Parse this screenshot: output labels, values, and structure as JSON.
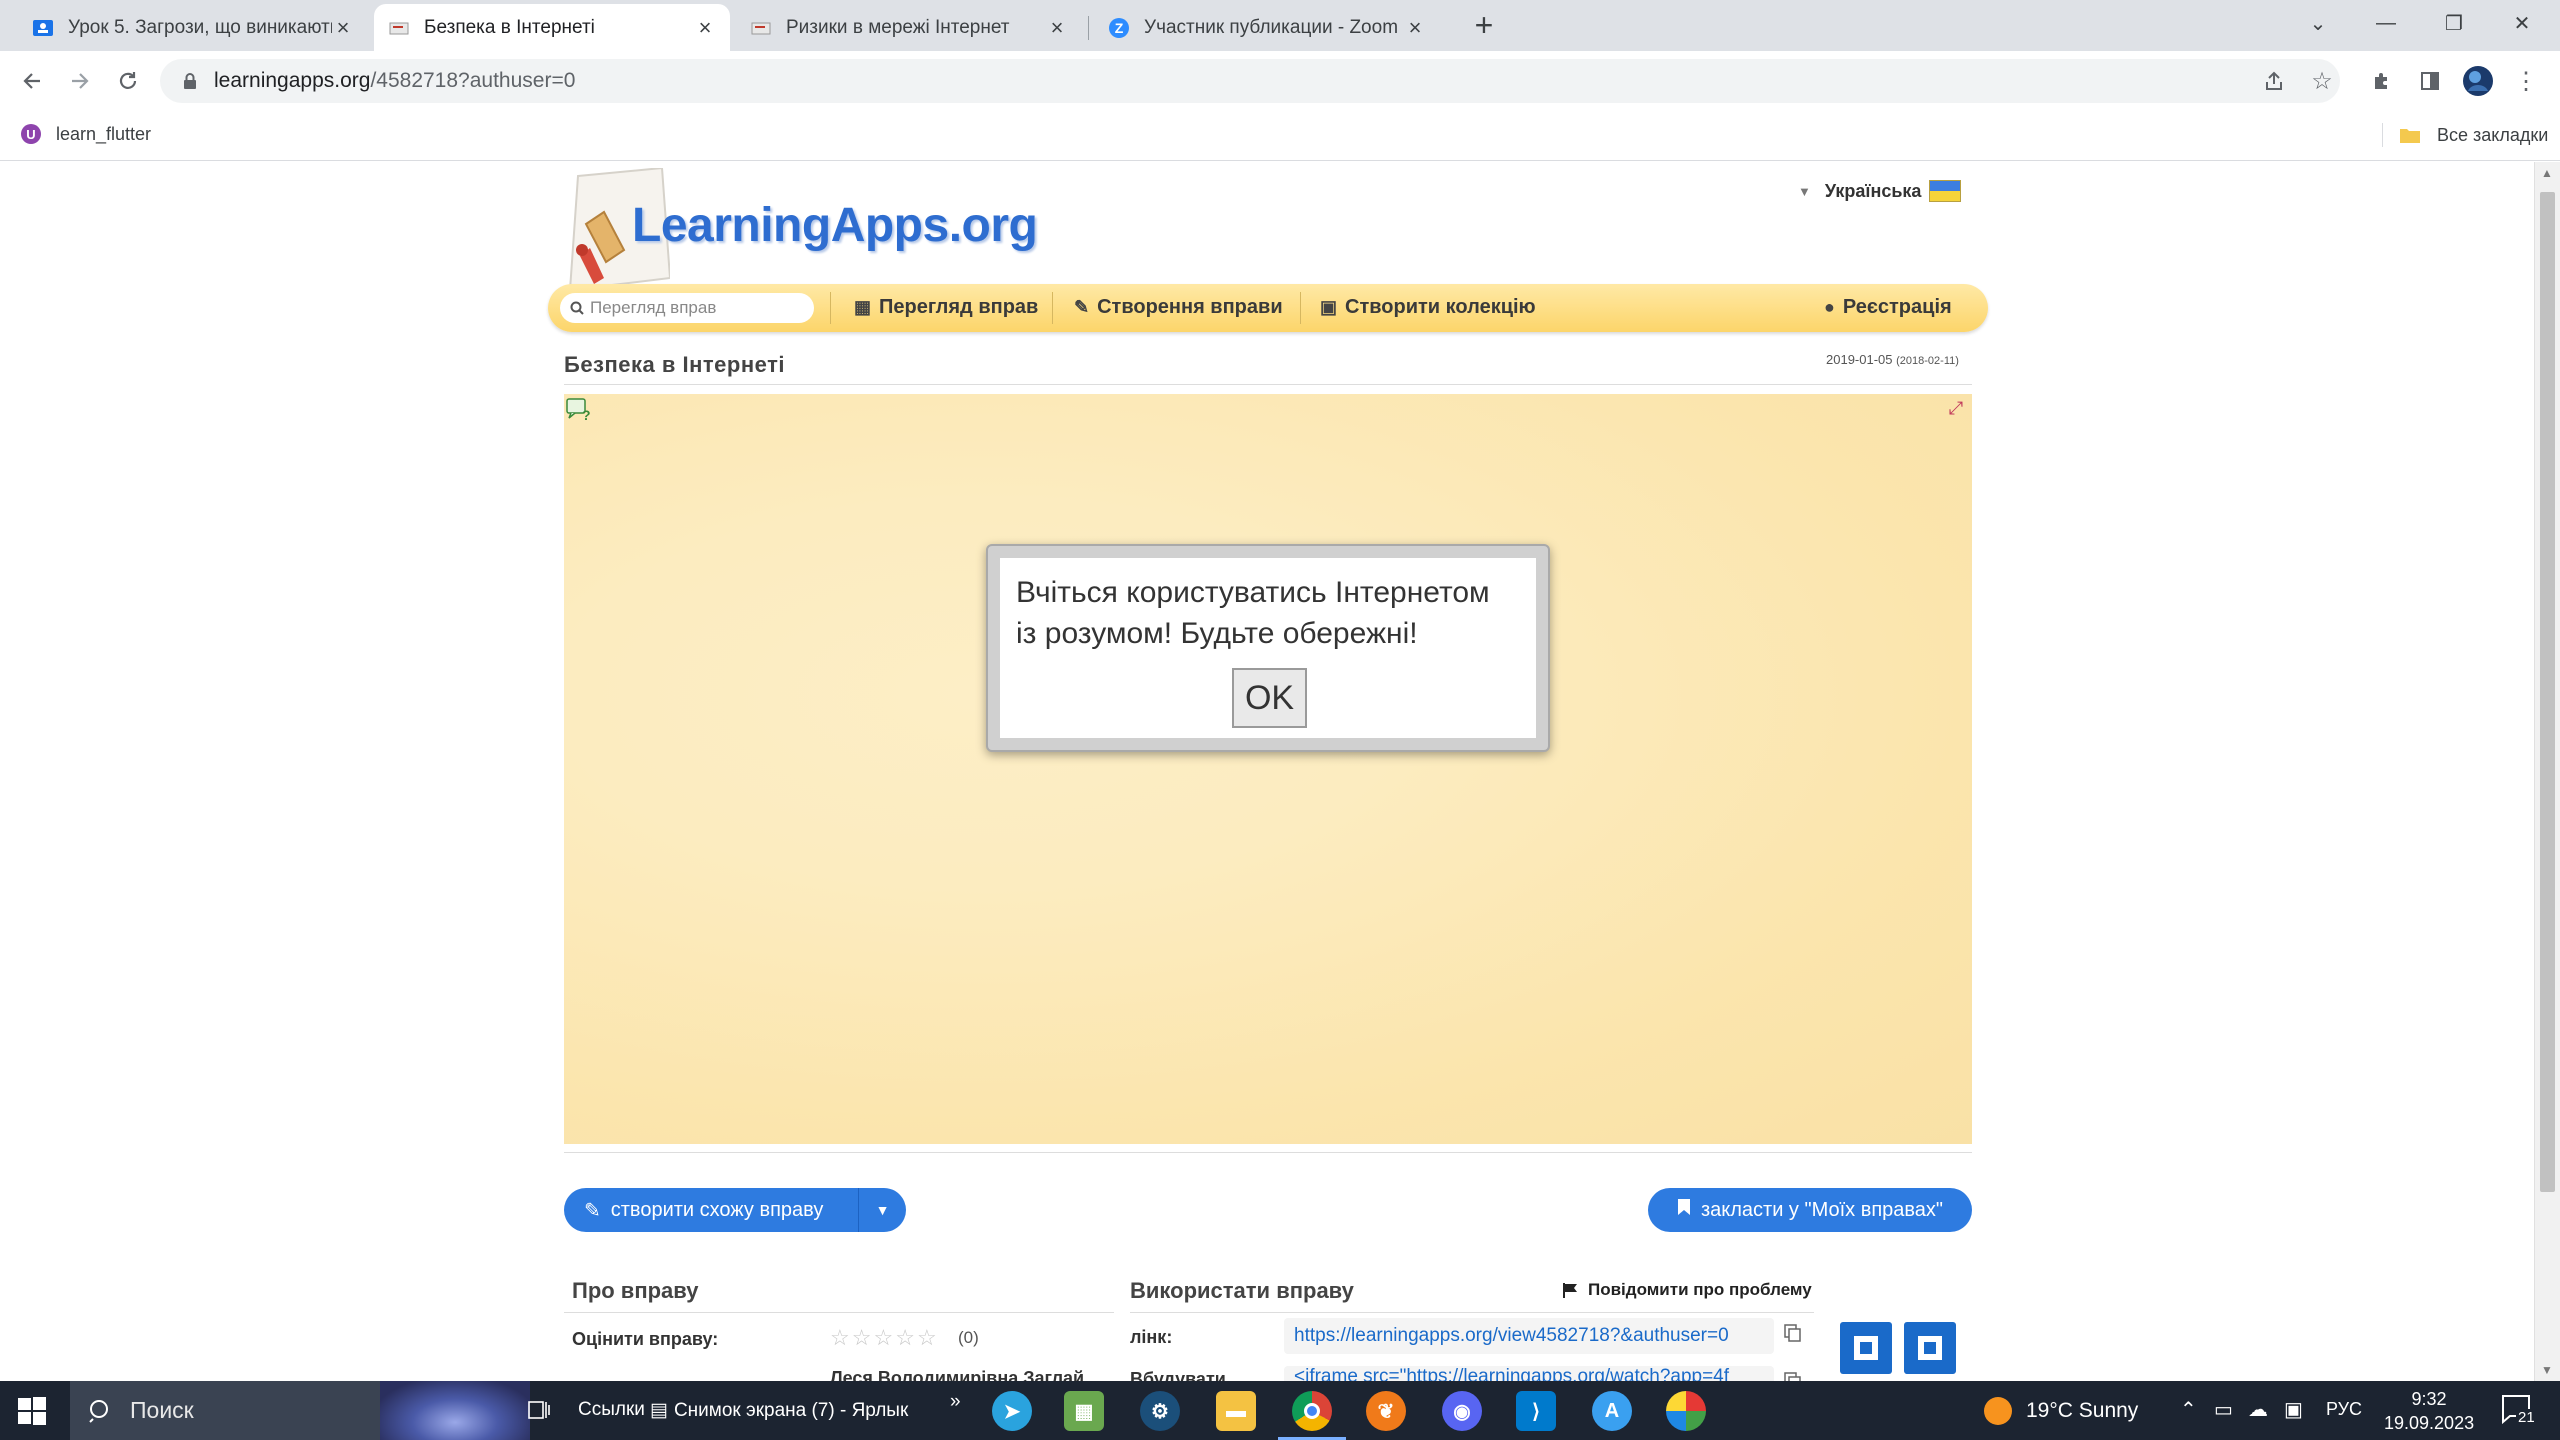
{
  "browser": {
    "tabs": [
      {
        "title": "Урок 5. Загрози, що виникають"
      },
      {
        "title": "Безпека в Інтернеті"
      },
      {
        "title": "Ризики в мережі Інтернет"
      },
      {
        "title": "Участник публикации - Zoom"
      }
    ],
    "url_host": "learningapps.org",
    "url_path": "/4582718?authuser=0",
    "bookmarks": {
      "left_item": "learn_flutter",
      "right_item": "Все закладки"
    }
  },
  "page": {
    "logo_text": "LearningApps.org",
    "language": "Українська",
    "search_placeholder": "Перегляд вправ",
    "nav": {
      "browse": "Перегляд вправ",
      "create": "Створення вправи",
      "collection": "Створити колекцію",
      "register": "Реєстрація"
    },
    "exercise_title": "Безпека в Інтернеті",
    "date_main": "2019-01-05",
    "date_small": "(2018-02-11)",
    "dialog": {
      "message": "Вчіться користуватись Інтернетом із розумом! Будьте обережні!",
      "ok_label": "OK"
    },
    "create_similar_label": "створити схожу вправу",
    "save_label": "закласти у \"Моїх вправах\"",
    "about_title": "Про вправу",
    "use_title": "Використати вправу",
    "report_label": "Повідомити про проблему",
    "rate_label": "Оцінити вправу:",
    "rating_count": "(0)",
    "author_partial": "Леся Володимирівна Заглай",
    "link_label": "лінк:",
    "link_value": "https://learningapps.org/view4582718?&authuser=0",
    "embed_label_partial": "Вбудувати",
    "embed_value_partial": "<iframe src=\"https://learningapps.org/watch?app=4f"
  },
  "taskbar": {
    "search_placeholder": "Поиск",
    "links_label": "Ссылки",
    "shortcut_label": "Снимок экрана (7) - Ярлык",
    "chevron": "»",
    "weather": "19°C  Sunny",
    "language": "РУС",
    "time": "9:32",
    "date": "19.09.2023",
    "notifications": "21"
  },
  "colors": {
    "accent_blue": "#2e7be0",
    "navbar_yellow": "#fcd56a",
    "app_background": "#fbe5ad"
  }
}
